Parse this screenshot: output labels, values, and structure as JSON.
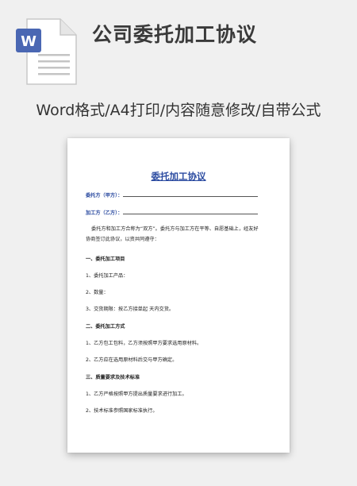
{
  "header": {
    "title": "公司委托加工协议",
    "subtitle": "Word格式/A4打印/内容随意修改/自带公式",
    "file_icon_letter": "W",
    "file_icon_color": "#4a67b3"
  },
  "document": {
    "title": "委托加工协议",
    "party_a_label": "委托方（甲方）：",
    "party_b_label": "加工方（乙方）：",
    "intro_line1": "委托方和加工方合称为“双方”。委托方与加工方在平等、自愿基础上，经友好",
    "intro_line2": "协商签订此协议，以资共同遵守：",
    "section1_heading": "一、委托加工项目",
    "s1_item1": "1、委托加工产品：",
    "s1_item2": "2、数量：",
    "s1_item3": "3、交货期限：按乙方接单起        天内交货。",
    "section2_heading": "二、委托加工方式",
    "s2_item1": "1、乙方包工包料，乙方须按照甲方要求选用原材料。",
    "s2_item2": "2、乙方应在选用原材料后交与甲方确定。",
    "section3_heading": "三、质量要求及技术标准",
    "s3_item1": "1、乙方严格按照甲方提出质量要求进行加工。",
    "s3_item2": "2、技术标准参照国家标准执行。"
  }
}
